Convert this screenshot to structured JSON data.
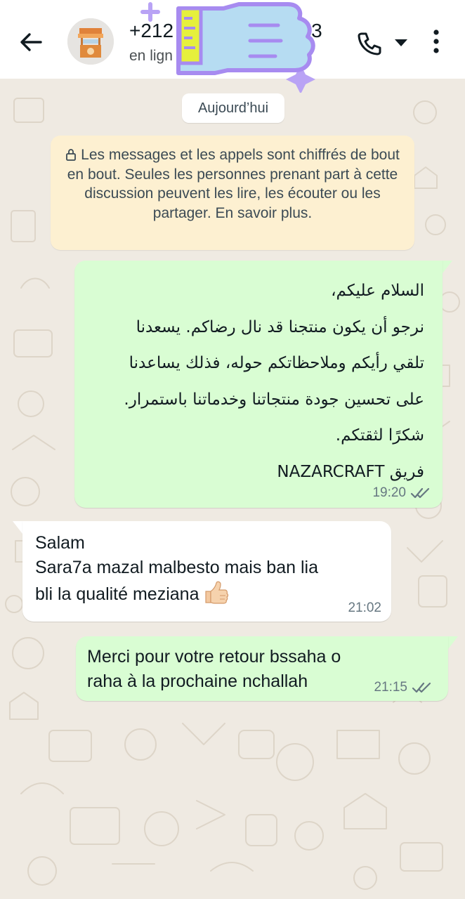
{
  "header": {
    "phone_number": "+212",
    "phone_suffix": "3",
    "status": "en lign"
  },
  "icons": {
    "back": "back-arrow-icon",
    "avatar": "shop-stall-avatar",
    "call": "phone-icon",
    "call_dropdown": "caret-down-icon",
    "menu": "more-vertical-icon",
    "lock": "lock-icon",
    "read": "double-check-icon",
    "thumb": "thumbs-up-emoji"
  },
  "chat": {
    "date_chip": "Aujourd’hui",
    "encryption_notice": "Les messages et les appels sont chiffrés de bout en bout. Seules les personnes prenant part à cette discussion peuvent les lire, les écouter ou les partager. En savoir plus.",
    "messages": [
      {
        "direction": "outgoing",
        "lines": [
          "السلام عليكم،",
          "نرجو أن يكون منتجنا قد نال رضاكم. يسعدنا",
          "تلقي رأيكم وملاحظاتكم حوله، فذلك يساعدنا",
          "على تحسين جودة منتجاتنا وخدماتنا باستمرار.",
          "شكرًا لثقتكم.",
          "فريق NAZARCRAFT"
        ],
        "time": "19:20",
        "status": "read"
      },
      {
        "direction": "incoming",
        "lines": [
          "Salam",
          "Sara7a mazal malbesto  mais ban lia",
          "bli la qualité meziana"
        ],
        "time": "21:02"
      },
      {
        "direction": "outgoing",
        "lines": [
          "Merci pour votre retour bssaha o",
          "raha à la prochaine nchallah"
        ],
        "time": "21:15",
        "status": "read"
      }
    ]
  },
  "colors": {
    "chat_background": "#efeae2",
    "outgoing_bubble": "#d9fdd3",
    "incoming_bubble": "#ffffff",
    "notice_background": "#fdf0d1",
    "read_ticks": "#667781"
  }
}
